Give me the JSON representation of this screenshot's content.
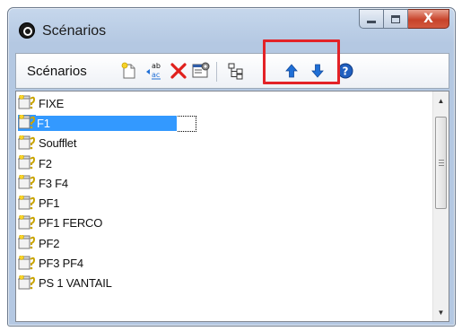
{
  "window": {
    "title": "Scénarios",
    "controls": {
      "minimize": "minimize",
      "maximize": "maximize",
      "close": "X"
    }
  },
  "toolbar": {
    "label": "Scénarios",
    "buttons": [
      {
        "name": "new-icon"
      },
      {
        "name": "rename-icon"
      },
      {
        "name": "delete-icon"
      },
      {
        "name": "properties-icon"
      },
      {
        "name": "tree-icon"
      },
      {
        "name": "arrow-up-icon"
      },
      {
        "name": "arrow-down-icon"
      },
      {
        "name": "help-icon"
      }
    ],
    "accent_highlight_color": "#e32227",
    "arrow_color": "#1f6fd6"
  },
  "list": {
    "items": [
      {
        "label": "FIXE"
      },
      {
        "label": "F1",
        "selected": true
      },
      {
        "label": "Soufflet"
      },
      {
        "label": "F2"
      },
      {
        "label": "F3 F4"
      },
      {
        "label": "PF1"
      },
      {
        "label": "PF1 FERCO"
      },
      {
        "label": "PF2"
      },
      {
        "label": "PF3 PF4"
      },
      {
        "label": "PS 1 VANTAIL"
      }
    ],
    "selection_color": "#3399ff"
  }
}
